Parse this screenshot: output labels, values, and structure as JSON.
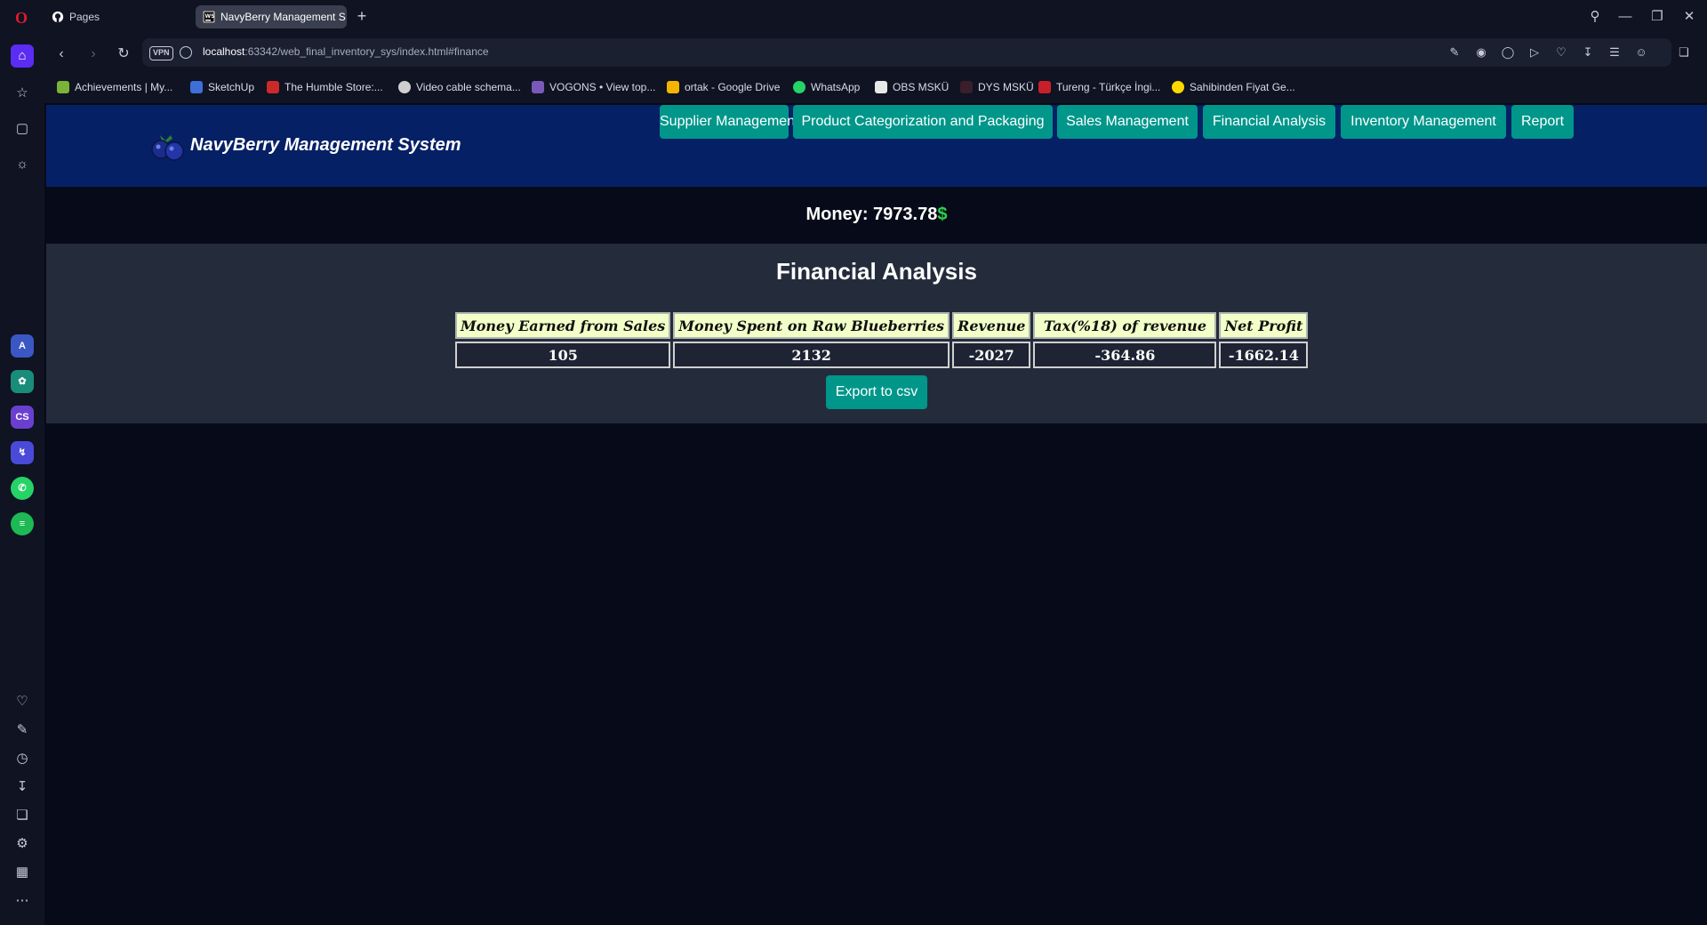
{
  "browser": {
    "tabs": [
      {
        "label": "Pages",
        "icon": "github-icon"
      },
      {
        "label": "NavyBerry Management S",
        "icon": "webstorm-icon",
        "active": true
      }
    ],
    "url": {
      "host": "localhost",
      "rest": ":63342/web_final_inventory_sys/index.html#finance"
    },
    "vpn_label": "VPN",
    "bookmarks": [
      "Achievements | My...",
      "SketchUp",
      "The Humble Store:...",
      "Video cable schema...",
      "VOGONS • View top...",
      "ortak - Google Drive",
      "WhatsApp",
      "OBS MSKÜ",
      "DYS MSKÜ",
      "Tureng - Türkçe İngi...",
      "Sahibinden Fiyat Ge..."
    ],
    "sidebar_app_labels": {
      "cs": "CS"
    }
  },
  "site": {
    "brand": "NavyBerry Management System",
    "nav": [
      "Supplier Management",
      "Product Categorization and Packaging",
      "Sales Management",
      "Financial Analysis",
      "Inventory Management",
      "Report"
    ],
    "money_label": "Money: 7973.78",
    "money_currency": "$",
    "section_title": "Financial Analysis",
    "table": {
      "headers": [
        "Money Earned from Sales",
        "Money Spent on Raw Blueberries",
        "Revenue",
        "Tax(%18) of revenue",
        "Net Profit"
      ],
      "row": [
        "105",
        "2132",
        "-2027",
        "-364.86",
        "-1662.14"
      ]
    },
    "export_label": "Export to csv"
  },
  "colors": {
    "header_bg": "#062065",
    "button_bg": "#00968a",
    "panel_bg": "#242c3c",
    "table_header_bg": "#f2ffc8",
    "currency_green": "#2fd04a"
  }
}
